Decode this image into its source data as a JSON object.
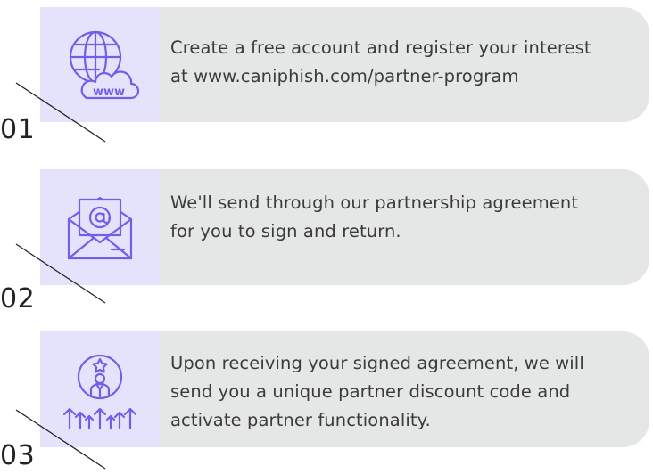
{
  "colors": {
    "card_bg": "#e5e6e6",
    "icon_tile_bg": "#e4e3fb",
    "icon_stroke": "#7060e8",
    "text": "#3b3b3b",
    "number": "#222222"
  },
  "steps": [
    {
      "number": "01",
      "icon": "globe-www-icon",
      "text": "Create a free account and register your interest at www.caniphish.com/partner-program",
      "lines": [
        "Create a free account and register your interest",
        "at www.caniphish.com/partner-program"
      ],
      "icon_label": "www"
    },
    {
      "number": "02",
      "icon": "envelope-at-icon",
      "lines": [
        "We'll send through our partnership agreement",
        "for you to sign and return."
      ],
      "icon_label": "@"
    },
    {
      "number": "03",
      "icon": "partner-growth-icon",
      "lines": [
        "Upon receiving your signed agreement, we will",
        "send you a unique partner discount code and",
        "activate partner functionality."
      ]
    }
  ]
}
